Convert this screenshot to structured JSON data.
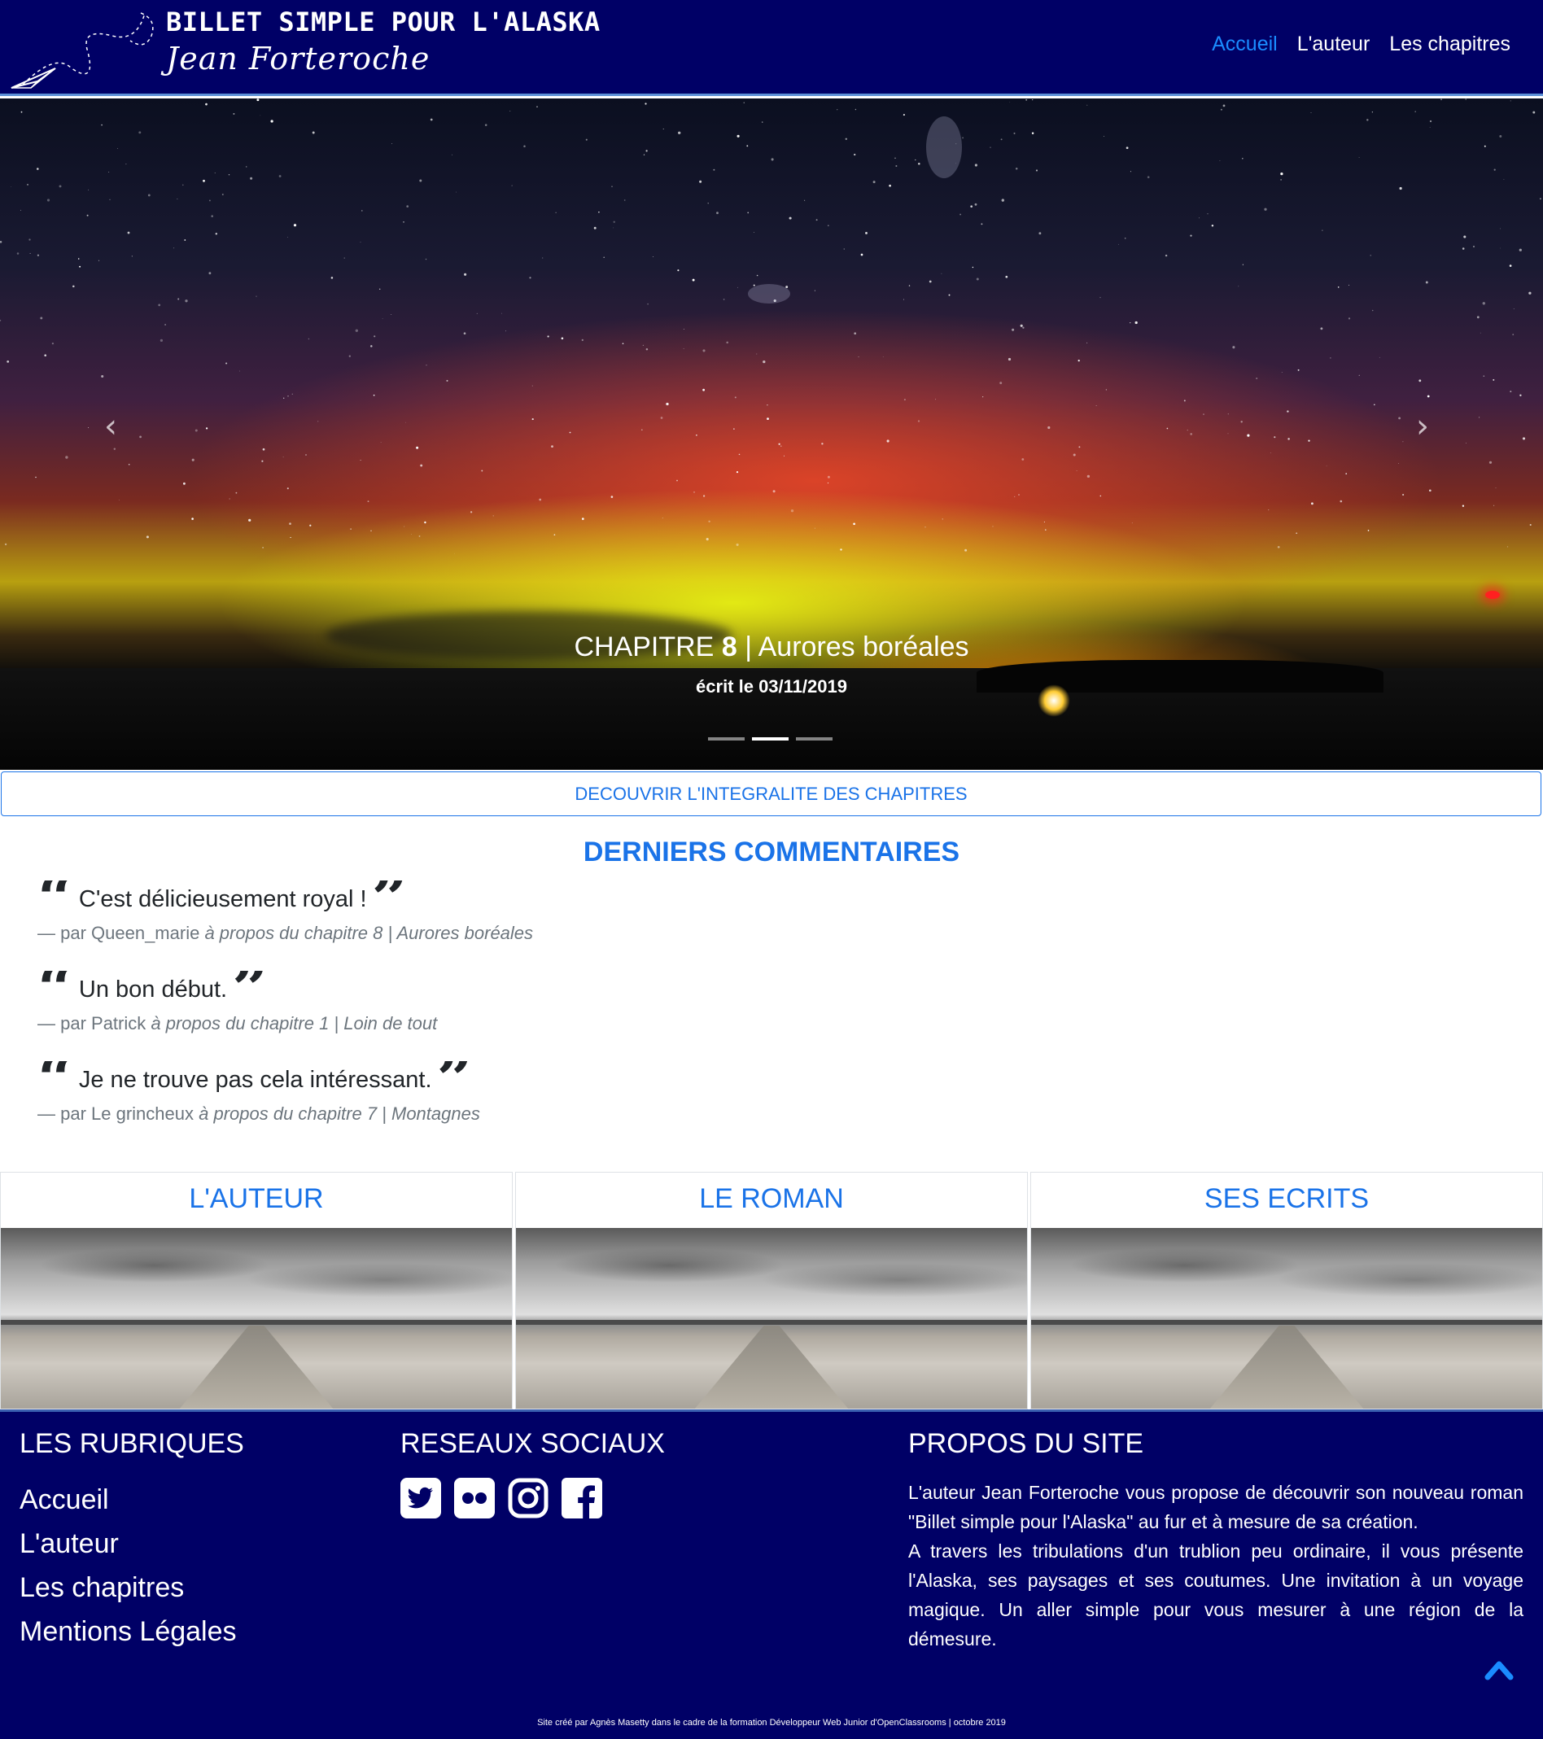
{
  "header": {
    "title": "BILLET SIMPLE POUR L'ALASKA",
    "author": "Jean Forteroche",
    "nav": [
      {
        "label": "Accueil",
        "active": true
      },
      {
        "label": "L'auteur",
        "active": false
      },
      {
        "label": "Les chapitres",
        "active": false
      }
    ]
  },
  "carousel": {
    "chapter_prefix": "CHAPITRE",
    "chapter_number": "8",
    "chapter_separator": "|",
    "chapter_title": "Aurores boréales",
    "date_text": "écrit le 03/11/2019",
    "slide_count": 3,
    "active_slide": 2,
    "prev_icon": "chevron-left-icon",
    "next_icon": "chevron-right-icon"
  },
  "discover_button": "DECOUVRIR L'INTEGRALITE DES CHAPITRES",
  "comments_section": {
    "title": "DERNIERS COMMENTAIRES",
    "items": [
      {
        "text": "C'est délicieusement royal !",
        "by": "— par Queen_marie",
        "about": "à propos du chapitre 8 | Aurores boréales"
      },
      {
        "text": "Un bon début.",
        "by": "— par Patrick",
        "about": "à propos du chapitre 1 | Loin de tout"
      },
      {
        "text": "Je ne trouve pas cela intéressant.",
        "by": "— par Le grincheux",
        "about": "à propos du chapitre 7 | Montagnes"
      }
    ]
  },
  "cards": [
    {
      "title": "L'AUTEUR"
    },
    {
      "title": "LE ROMAN"
    },
    {
      "title": "SES ECRITS"
    }
  ],
  "footer": {
    "rubriques_title": "LES RUBRIQUES",
    "rubriques": [
      "Accueil",
      "L'auteur",
      "Les chapitres",
      "Mentions Légales"
    ],
    "social_title": "RESEAUX SOCIAUX",
    "social_icons": [
      "twitter-icon",
      "flickr-icon",
      "instagram-icon",
      "facebook-icon"
    ],
    "about_title": "PROPOS DU SITE",
    "about_p1": "L'auteur Jean Forteroche vous propose de découvrir son nouveau roman \"Billet simple pour l'Alaska\" au fur et à mesure de sa création.",
    "about_p2": "A travers les tribulations d'un trublion peu ordinaire, il vous présente l'Alaska, ses paysages et ses coutumes. Une invitation à un voyage magique. Un aller simple pour vous mesurer à une région de la démesure.",
    "credit": "Site créé par Agnès Masetty dans le cadre de la formation Développeur Web Junior d'OpenClassrooms | octobre 2019",
    "back_to_top_icon": "chevron-up-icon"
  },
  "colors": {
    "navy": "#000066",
    "accent_blue": "#1a73e8",
    "nav_active": "#1a8cff",
    "muted_text": "#6c757d"
  }
}
